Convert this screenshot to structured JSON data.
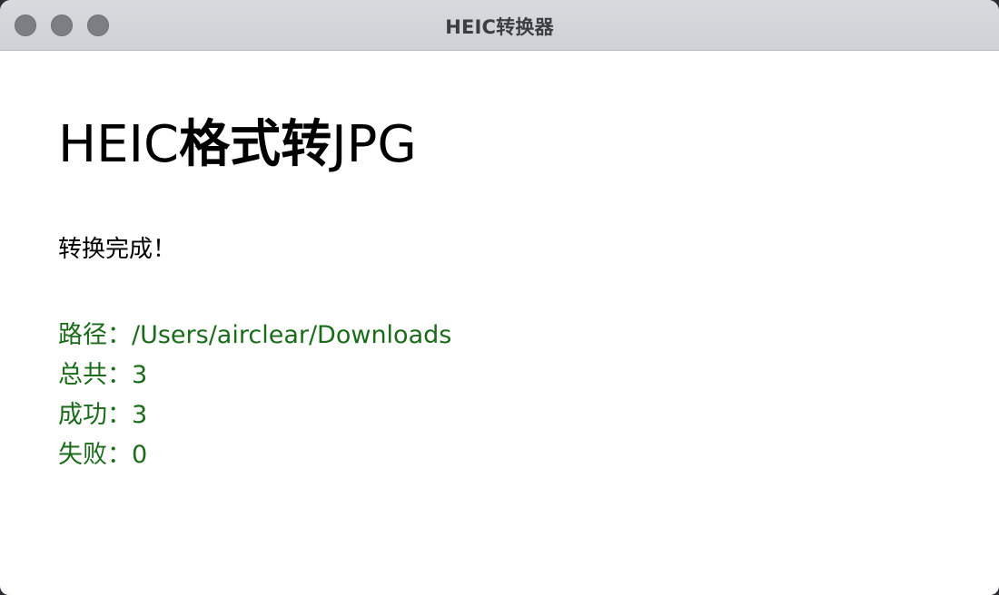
{
  "window": {
    "title": "HEIC转换器"
  },
  "main": {
    "heading_prefix": "HEIC",
    "heading_cjk": "格式转",
    "heading_suffix": "JPG",
    "status": "转换完成！",
    "results": [
      {
        "label": "路径：",
        "value": "/Users/airclear/Downloads"
      },
      {
        "label": "总共：",
        "value": "3"
      },
      {
        "label": "成功：",
        "value": "3"
      },
      {
        "label": "失败：",
        "value": "0"
      }
    ]
  },
  "colors": {
    "result_text": "#1a6b1a",
    "titlebar": "#d3d4d9",
    "traffic_light": "#7c7e83"
  }
}
